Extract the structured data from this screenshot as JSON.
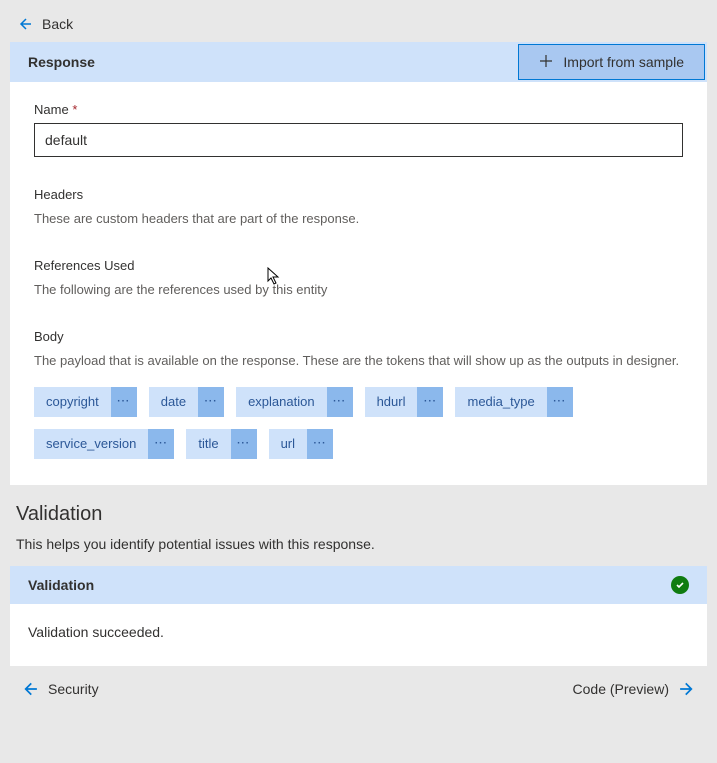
{
  "back": {
    "label": "Back"
  },
  "panel": {
    "title": "Response",
    "import_label": "Import from sample"
  },
  "name_field": {
    "label": "Name",
    "required_mark": "*",
    "value": "default"
  },
  "headers_section": {
    "title": "Headers",
    "desc": "These are custom headers that are part of the response."
  },
  "references_section": {
    "title": "References Used",
    "desc": "The following are the references used by this entity"
  },
  "body_section": {
    "title": "Body",
    "desc": "The payload that is available on the response. These are the tokens that will show up as the outputs in designer.",
    "tokens": [
      "copyright",
      "date",
      "explanation",
      "hdurl",
      "media_type",
      "service_version",
      "title",
      "url"
    ]
  },
  "validation": {
    "heading": "Validation",
    "sub": "This helps you identify potential issues with this response.",
    "panel_title": "Validation",
    "message": "Validation succeeded."
  },
  "footer": {
    "prev": "Security",
    "next": "Code (Preview)"
  }
}
